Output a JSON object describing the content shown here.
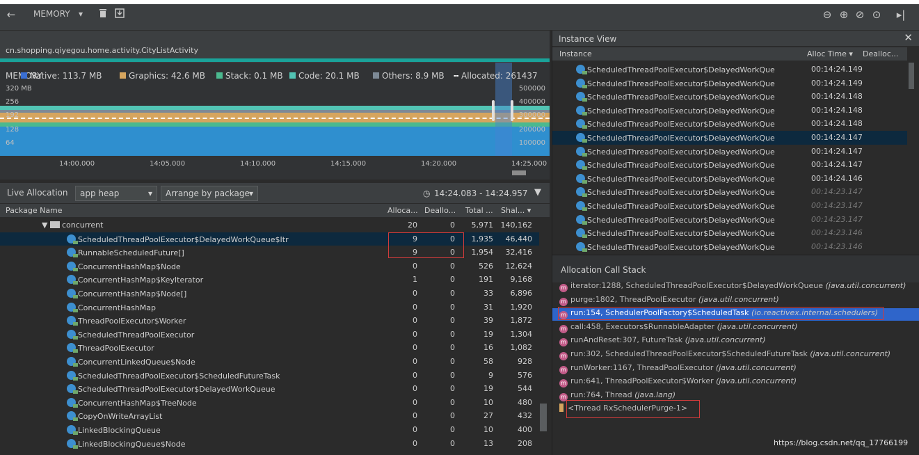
{
  "toolbar": {
    "title": "MEMORY",
    "back_icon": "←",
    "dropdown_icon": "▾"
  },
  "process": {
    "name": "cn.shopping.qiyegou.home.activity.CityListActivity"
  },
  "timeline": {
    "memory_label": "MEMORY",
    "legend": [
      {
        "label": "Native: 113.7 MB",
        "color": "#3a6fd3"
      },
      {
        "label": "Graphics: 42.6 MB",
        "color": "#d6a55e"
      },
      {
        "label": "Stack: 0.1 MB",
        "color": "#4bb98f"
      },
      {
        "label": "Code: 20.1 MB",
        "color": "#52c4b4"
      },
      {
        "label": "Others: 8.9 MB",
        "color": "#7d8a96"
      },
      {
        "label": "Allocated: 261437",
        "color": "#ffffff"
      }
    ],
    "y_left": [
      "320 MB",
      "256",
      "192",
      "128",
      "64"
    ],
    "y_right": [
      "500000",
      "400000",
      "300000",
      "200000",
      "100000"
    ],
    "x_ticks": [
      "14:00.000",
      "14:05.000",
      "14:10.000",
      "14:15.000",
      "14:20.000",
      "14:25.000"
    ]
  },
  "live": {
    "label": "Live Allocation",
    "heap": "app heap",
    "arrange": "Arrange by package",
    "range": "14:24.083 - 14:24.957"
  },
  "table": {
    "headers": [
      "Package Name",
      "Alloca...",
      "Deallo...",
      "Total ...",
      "Shal..."
    ],
    "rows": [
      {
        "name": "concurrent",
        "type": "package",
        "alloc": "20",
        "dealloc": "0",
        "total": "5,971",
        "shallow": "140,162"
      },
      {
        "name": "ScheduledThreadPoolExecutor$DelayedWorkQueue$Itr",
        "alloc": "9",
        "dealloc": "0",
        "total": "1,935",
        "shallow": "46,440"
      },
      {
        "name": "RunnableScheduledFuture[]",
        "alloc": "9",
        "dealloc": "0",
        "total": "1,954",
        "shallow": "32,416"
      },
      {
        "name": "ConcurrentHashMap$Node",
        "alloc": "0",
        "dealloc": "0",
        "total": "526",
        "shallow": "12,624"
      },
      {
        "name": "ConcurrentHashMap$KeyIterator",
        "alloc": "1",
        "dealloc": "0",
        "total": "191",
        "shallow": "9,168"
      },
      {
        "name": "ConcurrentHashMap$Node[]",
        "alloc": "0",
        "dealloc": "0",
        "total": "33",
        "shallow": "6,896"
      },
      {
        "name": "ConcurrentHashMap",
        "alloc": "0",
        "dealloc": "0",
        "total": "31",
        "shallow": "1,920"
      },
      {
        "name": "ThreadPoolExecutor$Worker",
        "alloc": "0",
        "dealloc": "0",
        "total": "39",
        "shallow": "1,872"
      },
      {
        "name": "ScheduledThreadPoolExecutor",
        "alloc": "0",
        "dealloc": "0",
        "total": "19",
        "shallow": "1,304"
      },
      {
        "name": "ThreadPoolExecutor",
        "alloc": "0",
        "dealloc": "0",
        "total": "16",
        "shallow": "1,082"
      },
      {
        "name": "ConcurrentLinkedQueue$Node",
        "alloc": "0",
        "dealloc": "0",
        "total": "58",
        "shallow": "928"
      },
      {
        "name": "ScheduledThreadPoolExecutor$ScheduledFutureTask",
        "alloc": "0",
        "dealloc": "0",
        "total": "9",
        "shallow": "576"
      },
      {
        "name": "ScheduledThreadPoolExecutor$DelayedWorkQueue",
        "alloc": "0",
        "dealloc": "0",
        "total": "19",
        "shallow": "544"
      },
      {
        "name": "ConcurrentHashMap$TreeNode",
        "alloc": "0",
        "dealloc": "0",
        "total": "10",
        "shallow": "480"
      },
      {
        "name": "CopyOnWriteArrayList",
        "alloc": "0",
        "dealloc": "0",
        "total": "27",
        "shallow": "432"
      },
      {
        "name": "LinkedBlockingQueue",
        "alloc": "0",
        "dealloc": "0",
        "total": "10",
        "shallow": "400"
      },
      {
        "name": "LinkedBlockingQueue$Node",
        "alloc": "0",
        "dealloc": "0",
        "total": "13",
        "shallow": "208"
      }
    ]
  },
  "instance_view": {
    "title": "Instance View",
    "headers": [
      "Instance",
      "Alloc Time ▾",
      "Dealloc..."
    ],
    "rows": [
      {
        "name": "ScheduledThreadPoolExecutor$DelayedWorkQue",
        "time": "00:14:24.149"
      },
      {
        "name": "ScheduledThreadPoolExecutor$DelayedWorkQue",
        "time": "00:14:24.149"
      },
      {
        "name": "ScheduledThreadPoolExecutor$DelayedWorkQue",
        "time": "00:14:24.148"
      },
      {
        "name": "ScheduledThreadPoolExecutor$DelayedWorkQue",
        "time": "00:14:24.148"
      },
      {
        "name": "ScheduledThreadPoolExecutor$DelayedWorkQue",
        "time": "00:14:24.148"
      },
      {
        "name": "ScheduledThreadPoolExecutor$DelayedWorkQue",
        "time": "00:14:24.147"
      },
      {
        "name": "ScheduledThreadPoolExecutor$DelayedWorkQue",
        "time": "00:14:24.147"
      },
      {
        "name": "ScheduledThreadPoolExecutor$DelayedWorkQue",
        "time": "00:14:24.147"
      },
      {
        "name": "ScheduledThreadPoolExecutor$DelayedWorkQue",
        "time": "00:14:24.146"
      },
      {
        "name": "ScheduledThreadPoolExecutor$DelayedWorkQue",
        "time": "00:14:23.147"
      },
      {
        "name": "ScheduledThreadPoolExecutor$DelayedWorkQue",
        "time": "00:14:23.147"
      },
      {
        "name": "ScheduledThreadPoolExecutor$DelayedWorkQue",
        "time": "00:14:23.147"
      },
      {
        "name": "ScheduledThreadPoolExecutor$DelayedWorkQue",
        "time": "00:14:23.146"
      },
      {
        "name": "ScheduledThreadPoolExecutor$DelayedWorkQue",
        "time": "00:14:23.146"
      }
    ]
  },
  "call_stack": {
    "title": "Allocation Call Stack",
    "frames": [
      {
        "method": "iterator:1288, ScheduledThreadPoolExecutor$DelayedWorkQueue",
        "pkg": "(java.util.concurrent)"
      },
      {
        "method": "purge:1802, ThreadPoolExecutor",
        "pkg": "(java.util.concurrent)"
      },
      {
        "method": "run:154, SchedulerPoolFactory$ScheduledTask",
        "pkg": "(io.reactivex.internal.schedulers)"
      },
      {
        "method": "call:458, Executors$RunnableAdapter",
        "pkg": "(java.util.concurrent)"
      },
      {
        "method": "runAndReset:307, FutureTask",
        "pkg": "(java.util.concurrent)"
      },
      {
        "method": "run:302, ScheduledThreadPoolExecutor$ScheduledFutureTask",
        "pkg": "(java.util.concurrent)"
      },
      {
        "method": "runWorker:1167, ThreadPoolExecutor",
        "pkg": "(java.util.concurrent)"
      },
      {
        "method": "run:641, ThreadPoolExecutor$Worker",
        "pkg": "(java.util.concurrent)"
      },
      {
        "method": "run:764, Thread",
        "pkg": "(java.lang)"
      }
    ],
    "thread": "<Thread RxSchedulerPurge-1>"
  },
  "watermark": "https://blog.csdn.net/qq_17766199"
}
